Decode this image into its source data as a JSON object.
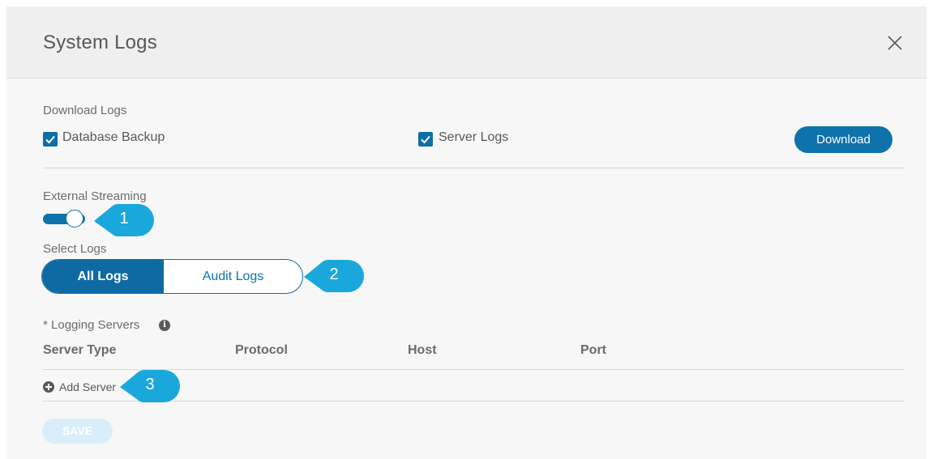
{
  "dialog": {
    "title": "System Logs",
    "close_icon": "close-icon"
  },
  "download_logs": {
    "label": "Download Logs",
    "database_backup": {
      "label": "Database Backup",
      "checked": true
    },
    "server_logs": {
      "label": "Server Logs",
      "checked": true
    },
    "download_button": "Download"
  },
  "external_streaming": {
    "label": "External Streaming",
    "enabled": true
  },
  "select_logs": {
    "label": "Select Logs",
    "options": [
      "All Logs",
      "Audit Logs"
    ],
    "selected": "All Logs"
  },
  "logging_servers": {
    "label": "* Logging Servers",
    "info_icon": "info-icon",
    "columns": [
      "Server Type",
      "Protocol",
      "Host",
      "Port"
    ],
    "add_server": "Add Server"
  },
  "save_button": "SAVE",
  "callouts": [
    "1",
    "2",
    "3"
  ],
  "colors": {
    "accent": "#0e72ab",
    "callout": "#1aa8dc",
    "save_disabled": "#d9eefa"
  }
}
